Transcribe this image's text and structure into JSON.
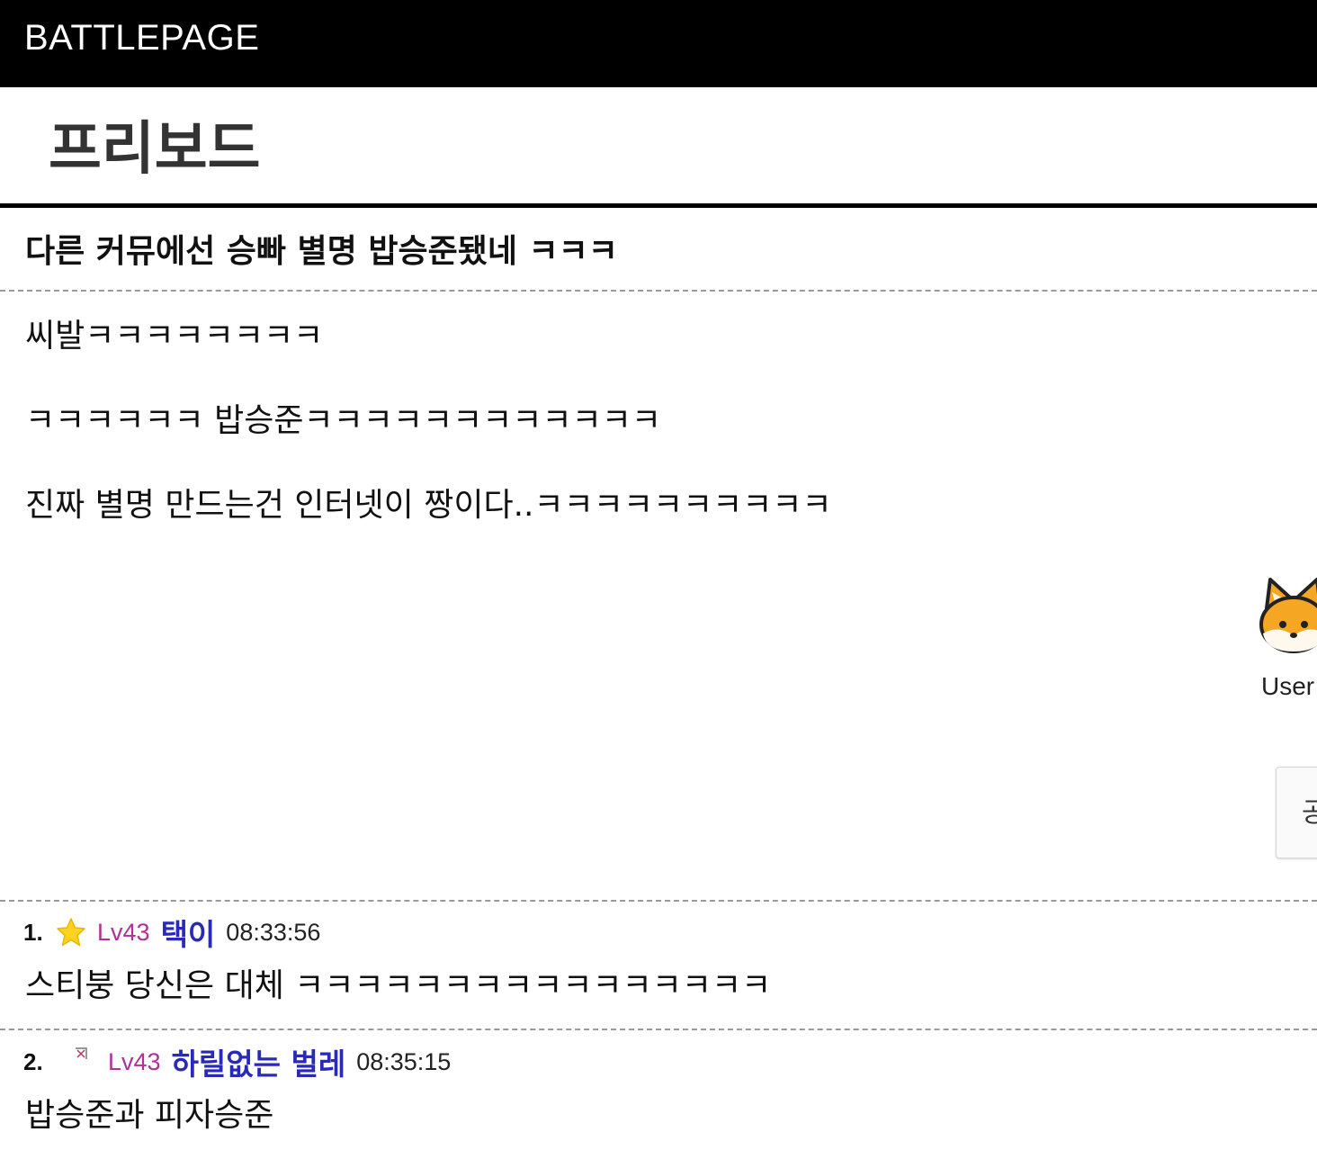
{
  "header": {
    "brand": "BATTLEPAGE"
  },
  "board": {
    "title": "프리보드"
  },
  "post": {
    "title": "다른 커뮤에선 승빠 별명 밥승준됐네 ㅋㅋㅋ",
    "body": [
      "씨발ㅋㅋㅋㅋㅋㅋㅋㅋ",
      "ㅋㅋㅋㅋㅋㅋ 밥승준ㅋㅋㅋㅋㅋㅋㅋㅋㅋㅋㅋㅋ",
      "진짜 별명 만드는건 인터넷이 짱이다..ㅋㅋㅋㅋㅋㅋㅋㅋㅋㅋ"
    ],
    "author": {
      "name": "User",
      "avatar_icon": "fox-face-icon"
    },
    "side_button_label": "공"
  },
  "comments": [
    {
      "number": "1.",
      "badge_icon": "star-icon",
      "level": "Lv43",
      "nickname": "택이",
      "time": "08:33:56",
      "text": "스티붕 당신은 대체 ㅋㅋㅋㅋㅋㅋㅋㅋㅋㅋㅋㅋㅋㅋㅋㅋ"
    },
    {
      "number": "2.",
      "badge_icon": "broken-image-icon",
      "level": "Lv43",
      "nickname": "하릴없는 벌레",
      "time": "08:35:15",
      "text": "밥승준과 피자승준"
    }
  ],
  "colors": {
    "topbar": "#000000",
    "level": "#b0309a",
    "nickname": "#2a2ab8"
  }
}
